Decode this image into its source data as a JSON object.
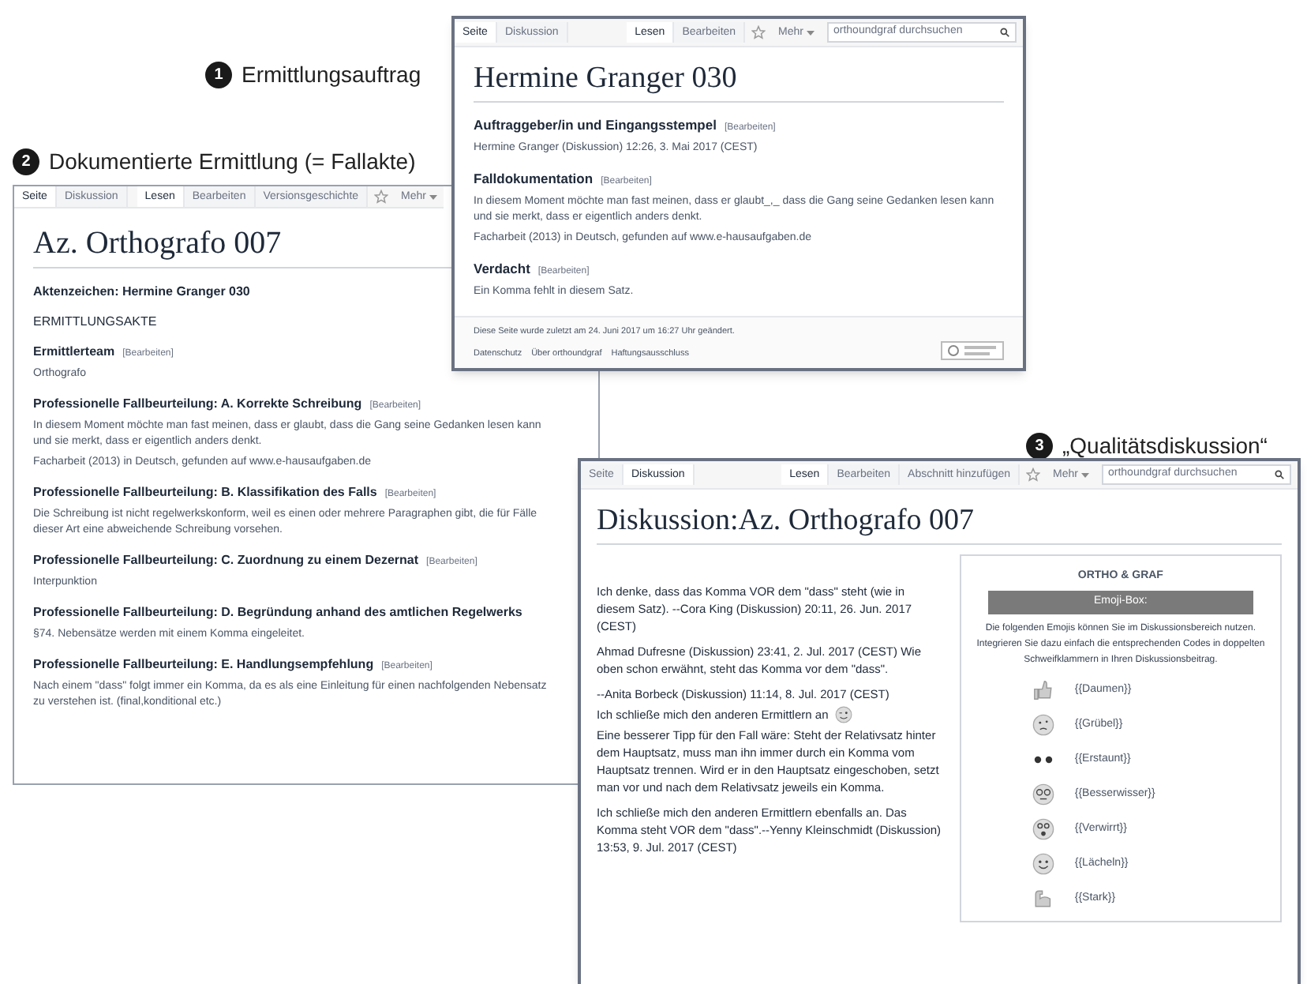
{
  "callouts": [
    {
      "number": "1",
      "label": "Ermittlungsauftrag"
    },
    {
      "number": "2",
      "label": "Dokumentierte Ermittlung (= Fallakte)"
    },
    {
      "number": "3",
      "label": "„Qualitätsdiskussion“"
    }
  ],
  "case_window": {
    "tabs_left": [
      {
        "label": "Seite",
        "selected": true
      },
      {
        "label": "Diskussion",
        "selected": false
      }
    ],
    "tabs_right": [
      {
        "label": "Lesen",
        "selected": true
      },
      {
        "label": "Bearbeiten",
        "selected": false
      }
    ],
    "more_menu": "Mehr",
    "search": {
      "placeholder": "orthoundgraf durchsuchen"
    },
    "title": "Hermine Granger 030",
    "sections": [
      {
        "heading": "Auftraggeber/in und Eingangsstempel",
        "edit": "[Bearbeiten]",
        "paragraphs": [
          "Hermine Granger (Diskussion) 12:26, 3. Mai 2017 (CEST)"
        ]
      },
      {
        "heading": "Falldokumentation",
        "edit": "[Bearbeiten]",
        "paragraphs": [
          "In diesem Moment möchte man fast meinen, dass er glaubt_,_ dass die Gang seine Gedanken lesen kann und sie merkt, dass er eigentlich anders denkt.",
          "Facharbeit (2013) in Deutsch, gefunden auf www.e-hausaufgaben.de"
        ]
      },
      {
        "heading": "Verdacht",
        "edit": "[Bearbeiten]",
        "paragraphs": [
          "Ein Komma fehlt in diesem Satz."
        ]
      }
    ],
    "footer": {
      "text": "Diese Seite wurde zuletzt am 24. Juni 2017 um 16:27 Uhr geändert.",
      "links": [
        "Datenschutz",
        "Über orthoundgraf",
        "Haftungsausschluss"
      ]
    }
  },
  "file_window": {
    "tabs_left": [
      {
        "label": "Seite",
        "selected": true
      },
      {
        "label": "Diskussion",
        "selected": false
      }
    ],
    "tabs_right": [
      {
        "label": "Lesen",
        "selected": true
      },
      {
        "label": "Bearbeiten",
        "selected": false
      },
      {
        "label": "Versionsgeschichte",
        "selected": false
      }
    ],
    "more_menu": "Mehr",
    "title": "Az. Orthografo 007",
    "file_number": "Aktenzeichen: Hermine Granger 030",
    "file_label": "ERMITTLUNGSAKTE",
    "sections": [
      {
        "heading": "Ermittlerteam",
        "edit": "[Bearbeiten]",
        "paragraphs": [
          "Orthografo"
        ]
      },
      {
        "heading": "Professionelle Fallbeurteilung: A. Korrekte Schreibung",
        "edit": "[Bearbeiten]",
        "paragraphs": [
          "In diesem Moment möchte man fast meinen, dass er glaubt, dass die Gang seine Gedanken lesen kann und sie merkt, dass er eigentlich anders denkt.",
          "Facharbeit (2013) in Deutsch, gefunden auf www.e-hausaufgaben.de"
        ]
      },
      {
        "heading": "Professionelle Fallbeurteilung: B. Klassifikation des Falls",
        "edit": "[Bearbeiten]",
        "paragraphs": [
          "Die Schreibung ist nicht regelwerkskonform, weil es einen oder mehrere Paragraphen gibt, die für Fälle dieser Art eine abweichende Schreibung vorsehen."
        ]
      },
      {
        "heading": "Professionelle Fallbeurteilung: C. Zuordnung zu einem Dezernat",
        "edit": "[Bearbeiten]",
        "paragraphs": [
          "Interpunktion"
        ]
      },
      {
        "heading": "Professionelle Fallbeurteilung: D. Begründung anhand des amtlichen Regelwerks",
        "paragraphs": [
          "§74. Nebensätze werden mit einem Komma eingeleitet."
        ]
      },
      {
        "heading": "Professionelle Fallbeurteilung: E. Handlungsempfehlung",
        "edit": "[Bearbeiten]",
        "paragraphs": [
          "Nach einem \"dass\" folgt immer ein Komma, da es als eine Einleitung für einen nachfolgenden Nebensatz zu verstehen ist. (final,konditional etc.)"
        ]
      }
    ]
  },
  "discussion_window": {
    "tabs_left": [
      {
        "label": "Seite",
        "selected": false
      },
      {
        "label": "Diskussion",
        "selected": true
      }
    ],
    "tabs_right": [
      {
        "label": "Lesen",
        "selected": true
      },
      {
        "label": "Bearbeiten",
        "selected": false
      },
      {
        "label": "Abschnitt hinzufügen",
        "selected": false
      }
    ],
    "more_menu": "Mehr",
    "search": {
      "placeholder": "orthoundgraf durchsuchen"
    },
    "title": "Diskussion:Az. Orthografo 007",
    "comments": [
      {
        "text": "Ich denke, dass das Komma VOR dem \"dass\" steht (wie in diesem Satz). --Cora King (Diskussion) 20:11, 26. Jun. 2017 (CEST)"
      },
      {
        "text": "Ahmad Dufresne (Diskussion) 23:41, 2. Jul. 2017 (CEST) Wie oben schon erwähnt, steht das Komma vor dem \"dass\"."
      },
      {
        "text": "--Anita Borbeck (Diskussion) 11:14, 8. Jul. 2017 (CEST)",
        "text_before_icon": "Ich schließe mich den anderen Ermittlern an",
        "text_after_icon": "Eine besserer Tipp für den Fall wäre: Steht der Relativsatz hinter dem Hauptsatz, muss man ihn immer durch ein Komma vom Hauptsatz trennen. Wird er in den Hauptsatz eingeschoben, setzt man vor und nach dem Relativsatz jeweils ein Komma."
      },
      {
        "text": "Ich schließe mich den anderen Ermittlern ebenfalls an. Das Komma steht VOR dem \"dass\".--Yenny Kleinschmidt (Diskussion) 13:53, 9. Jul. 2017 (CEST)"
      }
    ],
    "emoji_box": {
      "heading": "ORTHO & GRAF",
      "banner": "Emoji-Box:",
      "intro": "Die folgenden Emojis können Sie im Diskussionsbereich nutzen. Integrieren Sie dazu einfach die entsprechenden Codes in doppelten Schweifklammern in Ihren Diskussionsbeitrag.",
      "emojis": [
        {
          "code": "{{Daumen}}"
        },
        {
          "code": "{{Grübel}}"
        },
        {
          "code": "{{Erstaunt}}"
        },
        {
          "code": "{{Besserwisser}}"
        },
        {
          "code": "{{Verwirrt}}"
        },
        {
          "code": "{{Lächeln}}"
        },
        {
          "code": "{{Stark}}"
        }
      ]
    }
  }
}
